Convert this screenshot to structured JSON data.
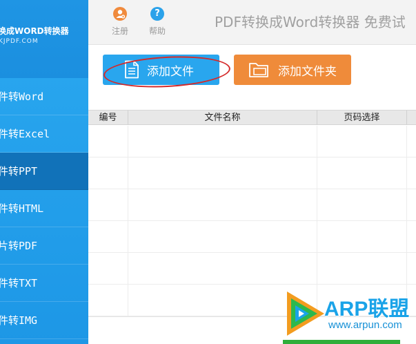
{
  "brand": {
    "title": "换成WORD转换器",
    "subtitle": "KJPDF.COM"
  },
  "toolbar": {
    "register_label": "注册",
    "help_label": "帮助",
    "app_title": "PDF转换成Word转换器 免费试"
  },
  "sidebar": {
    "items": [
      {
        "label": "件转Word",
        "active": false
      },
      {
        "label": "件转Excel",
        "active": false
      },
      {
        "label": "件转PPT",
        "active": true
      },
      {
        "label": "件转HTML",
        "active": false
      },
      {
        "label": "片转PDF",
        "active": false
      },
      {
        "label": "件转TXT",
        "active": false
      },
      {
        "label": "件转IMG",
        "active": false
      }
    ]
  },
  "actions": {
    "add_file_label": "添加文件",
    "add_folder_label": "添加文件夹"
  },
  "table": {
    "columns": [
      "编号",
      "文件名称",
      "页码选择"
    ]
  },
  "watermark": {
    "name": "ARP联盟",
    "url": "www.arpun.com"
  },
  "colors": {
    "sidebar": "#1d97e6",
    "active_item": "#1172b9",
    "add_file": "#29a6ee",
    "add_folder": "#ef8b3a",
    "annotation": "#d42a2a"
  }
}
